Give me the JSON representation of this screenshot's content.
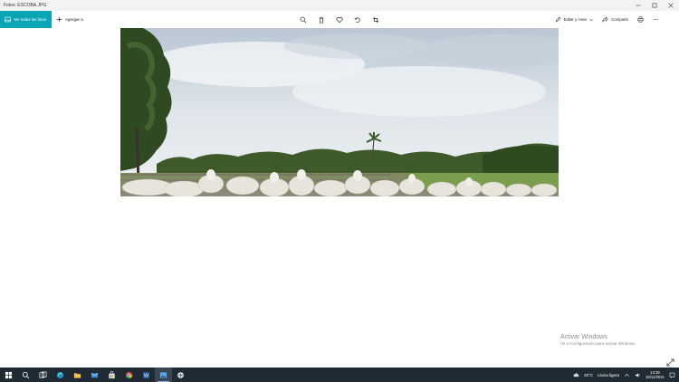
{
  "window": {
    "title": "Fotos: ESCOBA.JPG"
  },
  "toolbar": {
    "see_all_label": "Ver todas las fotos",
    "add_label": "Agregar a",
    "edit_label": "Editar y crear",
    "share_label": "Compartir"
  },
  "watermark": {
    "title": "Activar Windows",
    "subtitle": "Ve a Configuración para activar Windows."
  },
  "taskbar": {
    "weather_temp": "25°C",
    "weather_desc": "Lluvia ligera",
    "time": "13:39",
    "date": "15/12/2021"
  },
  "colors": {
    "accent": "#0aa5b5",
    "taskbar": "#1f2a33"
  }
}
